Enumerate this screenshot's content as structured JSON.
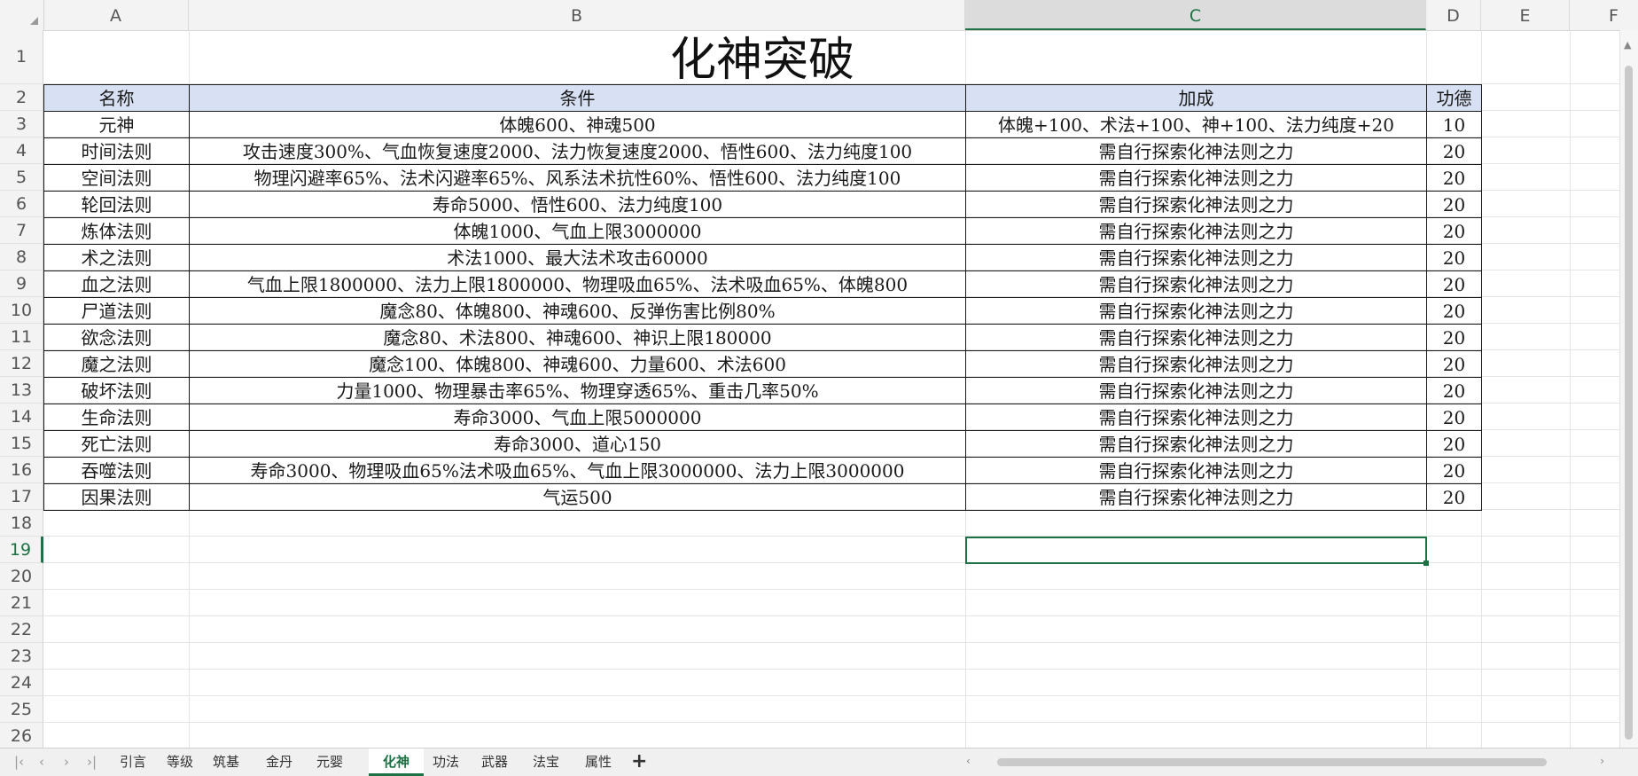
{
  "columns": [
    "A",
    "B",
    "C",
    "D",
    "E",
    "F"
  ],
  "active_column": "C",
  "row_numbers": [
    "1",
    "2",
    "3",
    "4",
    "5",
    "6",
    "7",
    "8",
    "9",
    "10",
    "11",
    "12",
    "13",
    "14",
    "15",
    "16",
    "17",
    "18",
    "19",
    "20",
    "21",
    "22",
    "23",
    "24",
    "25",
    "26"
  ],
  "active_row": "19",
  "title": "化神突破",
  "headers": {
    "name": "名称",
    "condition": "条件",
    "bonus": "加成",
    "merit": "功德"
  },
  "rows": [
    {
      "name": "元神",
      "condition": "体魄600、神魂500",
      "bonus": "体魄+100、术法+100、神+100、法力纯度+20",
      "merit": "10"
    },
    {
      "name": "时间法则",
      "condition": "攻击速度300%、气血恢复速度2000、法力恢复速度2000、悟性600、法力纯度100",
      "bonus": "需自行探索化神法则之力",
      "merit": "20"
    },
    {
      "name": "空间法则",
      "condition": "物理闪避率65%、法术闪避率65%、风系法术抗性60%、悟性600、法力纯度100",
      "bonus": "需自行探索化神法则之力",
      "merit": "20"
    },
    {
      "name": "轮回法则",
      "condition": "寿命5000、悟性600、法力纯度100",
      "bonus": "需自行探索化神法则之力",
      "merit": "20"
    },
    {
      "name": "炼体法则",
      "condition": "体魄1000、气血上限3000000",
      "bonus": "需自行探索化神法则之力",
      "merit": "20"
    },
    {
      "name": "术之法则",
      "condition": "术法1000、最大法术攻击60000",
      "bonus": "需自行探索化神法则之力",
      "merit": "20"
    },
    {
      "name": "血之法则",
      "condition": "气血上限1800000、法力上限1800000、物理吸血65%、法术吸血65%、体魄800",
      "bonus": "需自行探索化神法则之力",
      "merit": "20"
    },
    {
      "name": "尸道法则",
      "condition": "魔念80、体魄800、神魂600、反弹伤害比例80%",
      "bonus": "需自行探索化神法则之力",
      "merit": "20"
    },
    {
      "name": "欲念法则",
      "condition": "魔念80、术法800、神魂600、神识上限180000",
      "bonus": "需自行探索化神法则之力",
      "merit": "20"
    },
    {
      "name": "魔之法则",
      "condition": "魔念100、体魄800、神魂600、力量600、术法600",
      "bonus": "需自行探索化神法则之力",
      "merit": "20"
    },
    {
      "name": "破坏法则",
      "condition": "力量1000、物理暴击率65%、物理穿透65%、重击几率50%",
      "bonus": "需自行探索化神法则之力",
      "merit": "20"
    },
    {
      "name": "生命法则",
      "condition": "寿命3000、气血上限5000000",
      "bonus": "需自行探索化神法则之力",
      "merit": "20"
    },
    {
      "name": "死亡法则",
      "condition": "寿命3000、道心150",
      "bonus": "需自行探索化神法则之力",
      "merit": "20"
    },
    {
      "name": "吞噬法则",
      "condition": "寿命3000、物理吸血65%法术吸血65%、气血上限3000000、法力上限3000000",
      "bonus": "需自行探索化神法则之力",
      "merit": "20"
    },
    {
      "name": "因果法则",
      "condition": "气运500",
      "bonus": "需自行探索化神法则之力",
      "merit": "20"
    }
  ],
  "sheet_tabs": [
    "引言",
    "等级",
    "筑基",
    "金丹",
    "元婴",
    "化神",
    "功法",
    "武器",
    "法宝",
    "属性"
  ],
  "active_tab": "化神",
  "add_tab_label": "+",
  "colors": {
    "accent": "#1e7145",
    "header_fill": "#d8e1f3"
  }
}
